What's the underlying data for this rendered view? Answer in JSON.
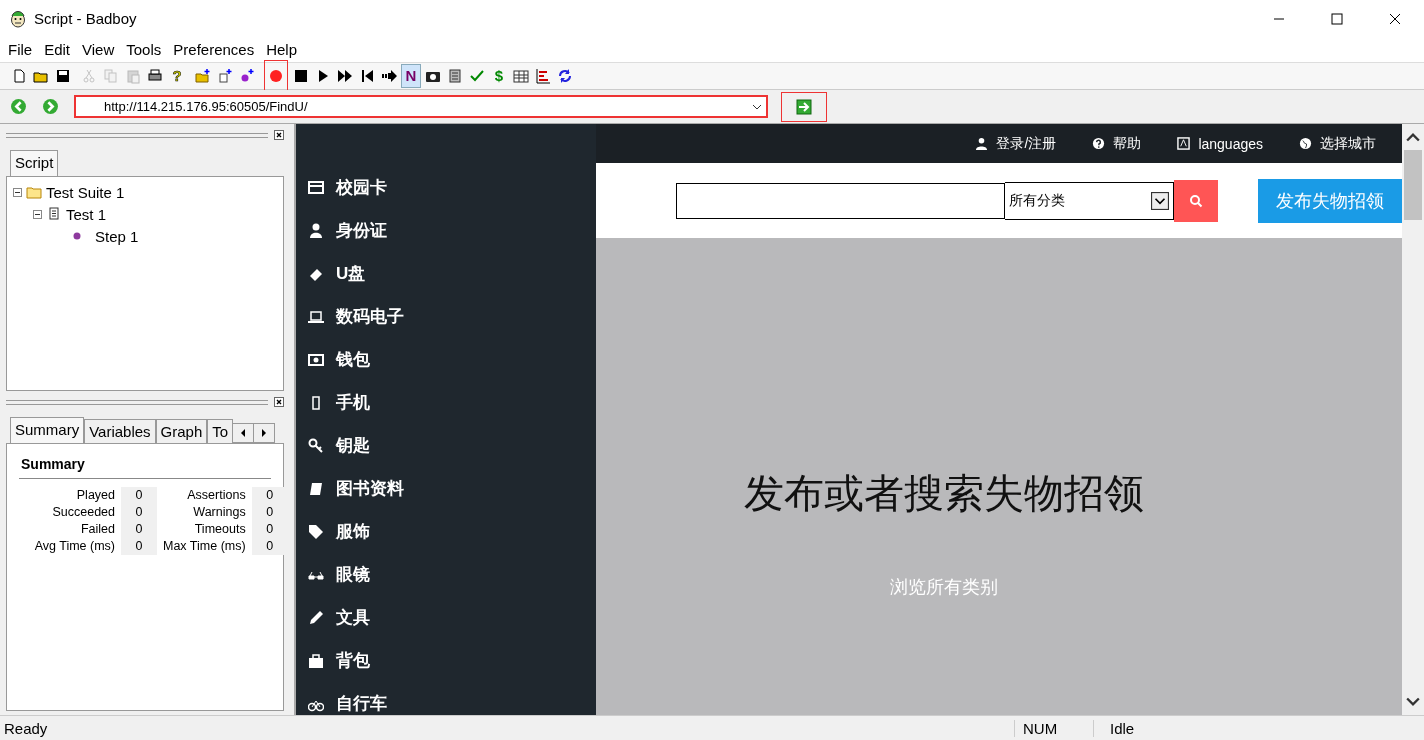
{
  "window": {
    "title": "Script - Badboy"
  },
  "menu": [
    "File",
    "Edit",
    "View",
    "Tools",
    "Preferences",
    "Help"
  ],
  "toolbar": [
    {
      "kind": "new"
    },
    {
      "kind": "open"
    },
    {
      "kind": "save"
    },
    {
      "kind": "cut",
      "disabled": true
    },
    {
      "kind": "copy",
      "disabled": true
    },
    {
      "kind": "paste",
      "disabled": true
    },
    {
      "kind": "print"
    },
    {
      "kind": "help",
      "glyph": "?"
    },
    {
      "kind": "add-suite"
    },
    {
      "kind": "add-test"
    },
    {
      "kind": "add-step"
    },
    {
      "kind": "record",
      "highlighted": true
    },
    {
      "kind": "stop"
    },
    {
      "kind": "play"
    },
    {
      "kind": "play-all"
    },
    {
      "kind": "rewind"
    },
    {
      "kind": "step-over"
    },
    {
      "kind": "n-mode",
      "glyph": "N",
      "pressed": true
    },
    {
      "kind": "camera"
    },
    {
      "kind": "document"
    },
    {
      "kind": "check"
    },
    {
      "kind": "dollar",
      "glyph": "$"
    },
    {
      "kind": "table"
    },
    {
      "kind": "chart"
    },
    {
      "kind": "refresh"
    }
  ],
  "address": {
    "value": "http://114.215.176.95:60505/FindU/",
    "highlighted": true,
    "go_highlighted": true
  },
  "script_panel": {
    "tab": "Script",
    "tree": [
      {
        "label": "Test Suite 1",
        "kind": "suite",
        "expanded": true,
        "children": [
          {
            "label": "Test 1",
            "kind": "test",
            "expanded": true,
            "children": [
              {
                "label": "Step 1",
                "kind": "step"
              }
            ]
          }
        ]
      }
    ]
  },
  "summary_panel": {
    "tabs": [
      {
        "label": "Summary",
        "selected": true
      },
      {
        "label": "Variables",
        "selected": false
      },
      {
        "label": "Graph",
        "selected": false
      },
      {
        "label": "To",
        "selected": false
      }
    ],
    "heading": "Summary",
    "stats": [
      {
        "label": "Played",
        "value": "0"
      },
      {
        "label": "Assertions",
        "value": "0"
      },
      {
        "label": "Succeeded",
        "value": "0"
      },
      {
        "label": "Warnings",
        "value": "0"
      },
      {
        "label": "Failed",
        "value": "0"
      },
      {
        "label": "Timeouts",
        "value": "0"
      },
      {
        "label": "Avg Time (ms)",
        "value": "0"
      },
      {
        "label": "Max Time (ms)",
        "value": "0"
      }
    ]
  },
  "site": {
    "top_links": [
      {
        "label": "登录/注册",
        "kind": "user"
      },
      {
        "label": "帮助",
        "kind": "help"
      },
      {
        "label": "languages",
        "kind": "language"
      },
      {
        "label": "选择城市",
        "kind": "globe"
      }
    ],
    "category_select": "所有分类",
    "publish_button": "发布失物招领",
    "categories": [
      {
        "label": "校园卡",
        "kind": "card"
      },
      {
        "label": "身份证",
        "kind": "user"
      },
      {
        "label": "U盘",
        "kind": "usb"
      },
      {
        "label": "数码电子",
        "kind": "laptop"
      },
      {
        "label": "钱包",
        "kind": "money"
      },
      {
        "label": "手机",
        "kind": "phone"
      },
      {
        "label": "钥匙",
        "kind": "key"
      },
      {
        "label": "图书资料",
        "kind": "book"
      },
      {
        "label": "服饰",
        "kind": "tag"
      },
      {
        "label": "眼镜",
        "kind": "glasses"
      },
      {
        "label": "文具",
        "kind": "pencil"
      },
      {
        "label": "背包",
        "kind": "bag"
      },
      {
        "label": "自行车",
        "kind": "bicycle"
      }
    ],
    "hero_title": "发布或者搜索失物招领",
    "hero_link": "浏览所有类别"
  },
  "status_bar": {
    "text": "Ready",
    "num": "NUM",
    "state": "Idle"
  }
}
